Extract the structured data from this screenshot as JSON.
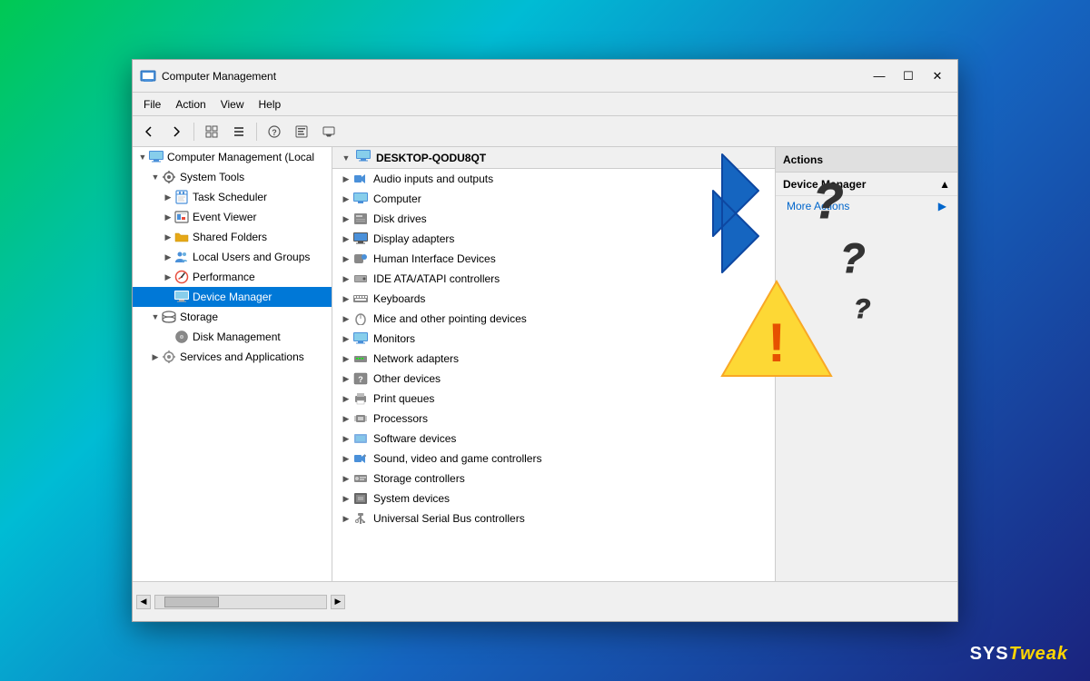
{
  "window": {
    "title": "Computer Management",
    "icon": "💻",
    "controls": {
      "minimize": "—",
      "maximize": "☐",
      "close": "✕"
    }
  },
  "menu": {
    "items": [
      "File",
      "Action",
      "View",
      "Help"
    ]
  },
  "toolbar": {
    "buttons": [
      "←",
      "→",
      "⊞",
      "⊟",
      "?",
      "▤",
      "🖥"
    ]
  },
  "left_panel": {
    "title": "Computer Management (Local",
    "items": [
      {
        "label": "Computer Management (Local",
        "indent": 0,
        "arrow": "▼",
        "icon": "💻",
        "selected": false
      },
      {
        "label": "System Tools",
        "indent": 1,
        "arrow": "▼",
        "icon": "🔧",
        "selected": false
      },
      {
        "label": "Task Scheduler",
        "indent": 2,
        "arrow": "▶",
        "icon": "📅",
        "selected": false
      },
      {
        "label": "Event Viewer",
        "indent": 2,
        "arrow": "▶",
        "icon": "📋",
        "selected": false
      },
      {
        "label": "Shared Folders",
        "indent": 2,
        "arrow": "▶",
        "icon": "📁",
        "selected": false
      },
      {
        "label": "Local Users and Groups",
        "indent": 2,
        "arrow": "▶",
        "icon": "👥",
        "selected": false
      },
      {
        "label": "Performance",
        "indent": 2,
        "arrow": "▶",
        "icon": "📊",
        "selected": false
      },
      {
        "label": "Device Manager",
        "indent": 2,
        "arrow": "",
        "icon": "🖥",
        "selected": true
      },
      {
        "label": "Storage",
        "indent": 1,
        "arrow": "▼",
        "icon": "💾",
        "selected": false
      },
      {
        "label": "Disk Management",
        "indent": 2,
        "arrow": "",
        "icon": "💿",
        "selected": false
      },
      {
        "label": "Services and Applications",
        "indent": 1,
        "arrow": "▶",
        "icon": "⚙",
        "selected": false
      }
    ]
  },
  "middle_panel": {
    "header": "DESKTOP-QODU8QT",
    "devices": [
      "Audio inputs and outputs",
      "Computer",
      "Disk drives",
      "Display adapters",
      "Human Interface Devices",
      "IDE ATA/ATAPI controllers",
      "Keyboards",
      "Mice and other pointing devices",
      "Monitors",
      "Network adapters",
      "Other devices",
      "Print queues",
      "Processors",
      "Software devices",
      "Sound, video and game controllers",
      "Storage controllers",
      "System devices",
      "Universal Serial Bus controllers"
    ]
  },
  "right_panel": {
    "header": "Actions",
    "section_title": "Device Manager",
    "links": [
      {
        "label": "More Actions",
        "hasArrow": true
      }
    ]
  },
  "status_bar": {
    "text": ""
  },
  "brand": {
    "sys": "SYS",
    "tweak": "Tweak"
  }
}
